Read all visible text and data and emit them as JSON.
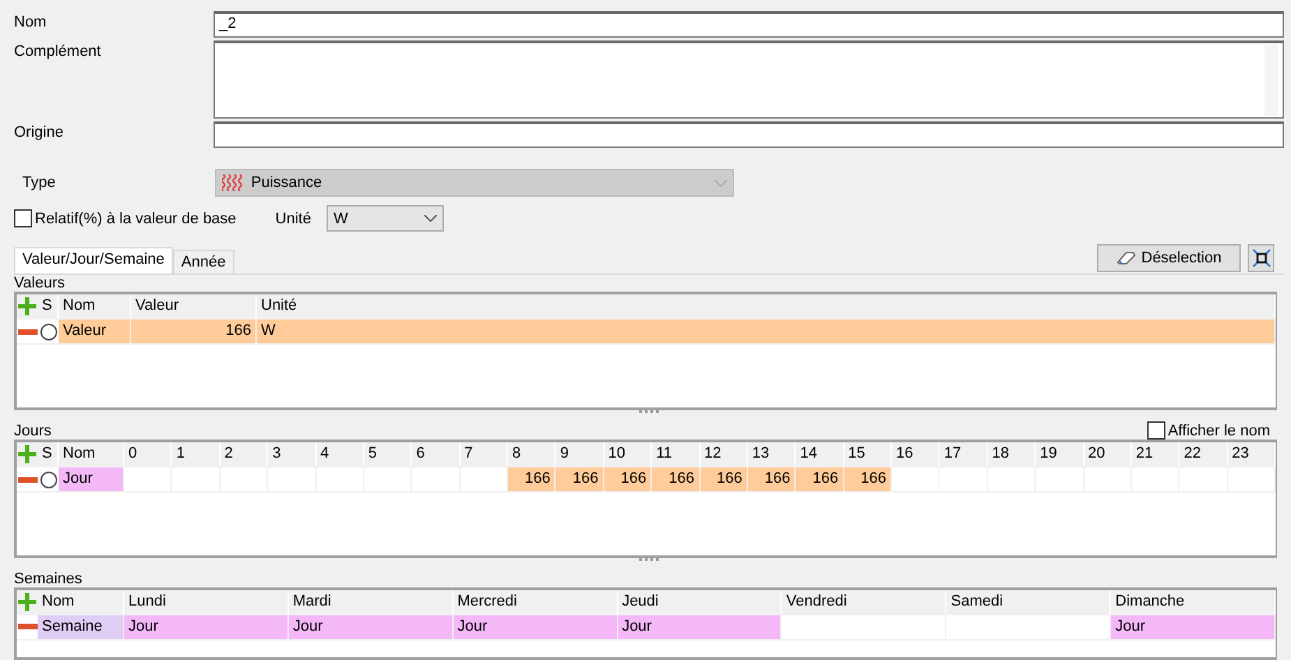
{
  "form": {
    "fields": [
      {
        "kind": "line",
        "label": "Nom",
        "value": "_2"
      },
      {
        "kind": "area",
        "label": "Complément"
      },
      {
        "kind": "line",
        "label": "Origine"
      }
    ],
    "type": {
      "label": "Type",
      "value": "Puissance",
      "disabled": true
    },
    "relative": {
      "label": "Relatif(%) à la valeur de base",
      "checked": false
    },
    "unit": {
      "label": "Unité",
      "value": "W"
    }
  },
  "tabs": [
    {
      "label": "Valeur/Jour/Semaine",
      "selected": true
    },
    {
      "label": "Année",
      "selected": false
    }
  ],
  "deselect_button": "Déselection",
  "valeurs": {
    "title": "Valeurs",
    "columns": [
      "S",
      "Nom",
      "Valeur",
      "Unité"
    ],
    "rows": [
      {
        "name": "Valeur",
        "value": "166",
        "unit": "W",
        "selected": false,
        "color": "#ffcc99"
      }
    ]
  },
  "jours": {
    "title": "Jours",
    "show_name": {
      "label": "Afficher le nom",
      "checked": false
    },
    "columns": [
      "S",
      "Nom",
      "0",
      "1",
      "2",
      "3",
      "4",
      "5",
      "6",
      "7",
      "8",
      "9",
      "10",
      "11",
      "12",
      "13",
      "14",
      "15",
      "16",
      "17",
      "18",
      "19",
      "20",
      "21",
      "22",
      "23"
    ],
    "rows": [
      {
        "name": "Jour",
        "selected": false,
        "color": "#f4b8f8",
        "cells": [
          {
            "filled": false
          },
          {
            "filled": false
          },
          {
            "filled": false
          },
          {
            "filled": false
          },
          {
            "filled": false
          },
          {
            "filled": false
          },
          {
            "filled": false
          },
          {
            "filled": false
          },
          {
            "filled": true,
            "value": "166"
          },
          {
            "filled": true,
            "value": "166"
          },
          {
            "filled": true,
            "value": "166"
          },
          {
            "filled": true,
            "value": "166"
          },
          {
            "filled": true,
            "value": "166"
          },
          {
            "filled": true,
            "value": "166"
          },
          {
            "filled": true,
            "value": "166"
          },
          {
            "filled": true,
            "value": "166"
          },
          {
            "filled": false
          },
          {
            "filled": false
          },
          {
            "filled": false
          },
          {
            "filled": false
          },
          {
            "filled": false
          },
          {
            "filled": false
          },
          {
            "filled": false
          },
          {
            "filled": false
          }
        ]
      }
    ]
  },
  "semaines": {
    "title": "Semaines",
    "columns": [
      "Nom",
      "Lundi",
      "Mardi",
      "Mercredi",
      "Jeudi",
      "Vendredi",
      "Samedi",
      "Dimanche"
    ],
    "rows": [
      {
        "name": "Semaine",
        "color": "#e0cdf5",
        "days": [
          {
            "filled": true,
            "value": "Jour"
          },
          {
            "filled": true,
            "value": "Jour"
          },
          {
            "filled": true,
            "value": "Jour"
          },
          {
            "filled": true,
            "value": "Jour"
          },
          {
            "filled": false
          },
          {
            "filled": false
          },
          {
            "filled": true,
            "value": "Jour"
          }
        ]
      }
    ]
  }
}
